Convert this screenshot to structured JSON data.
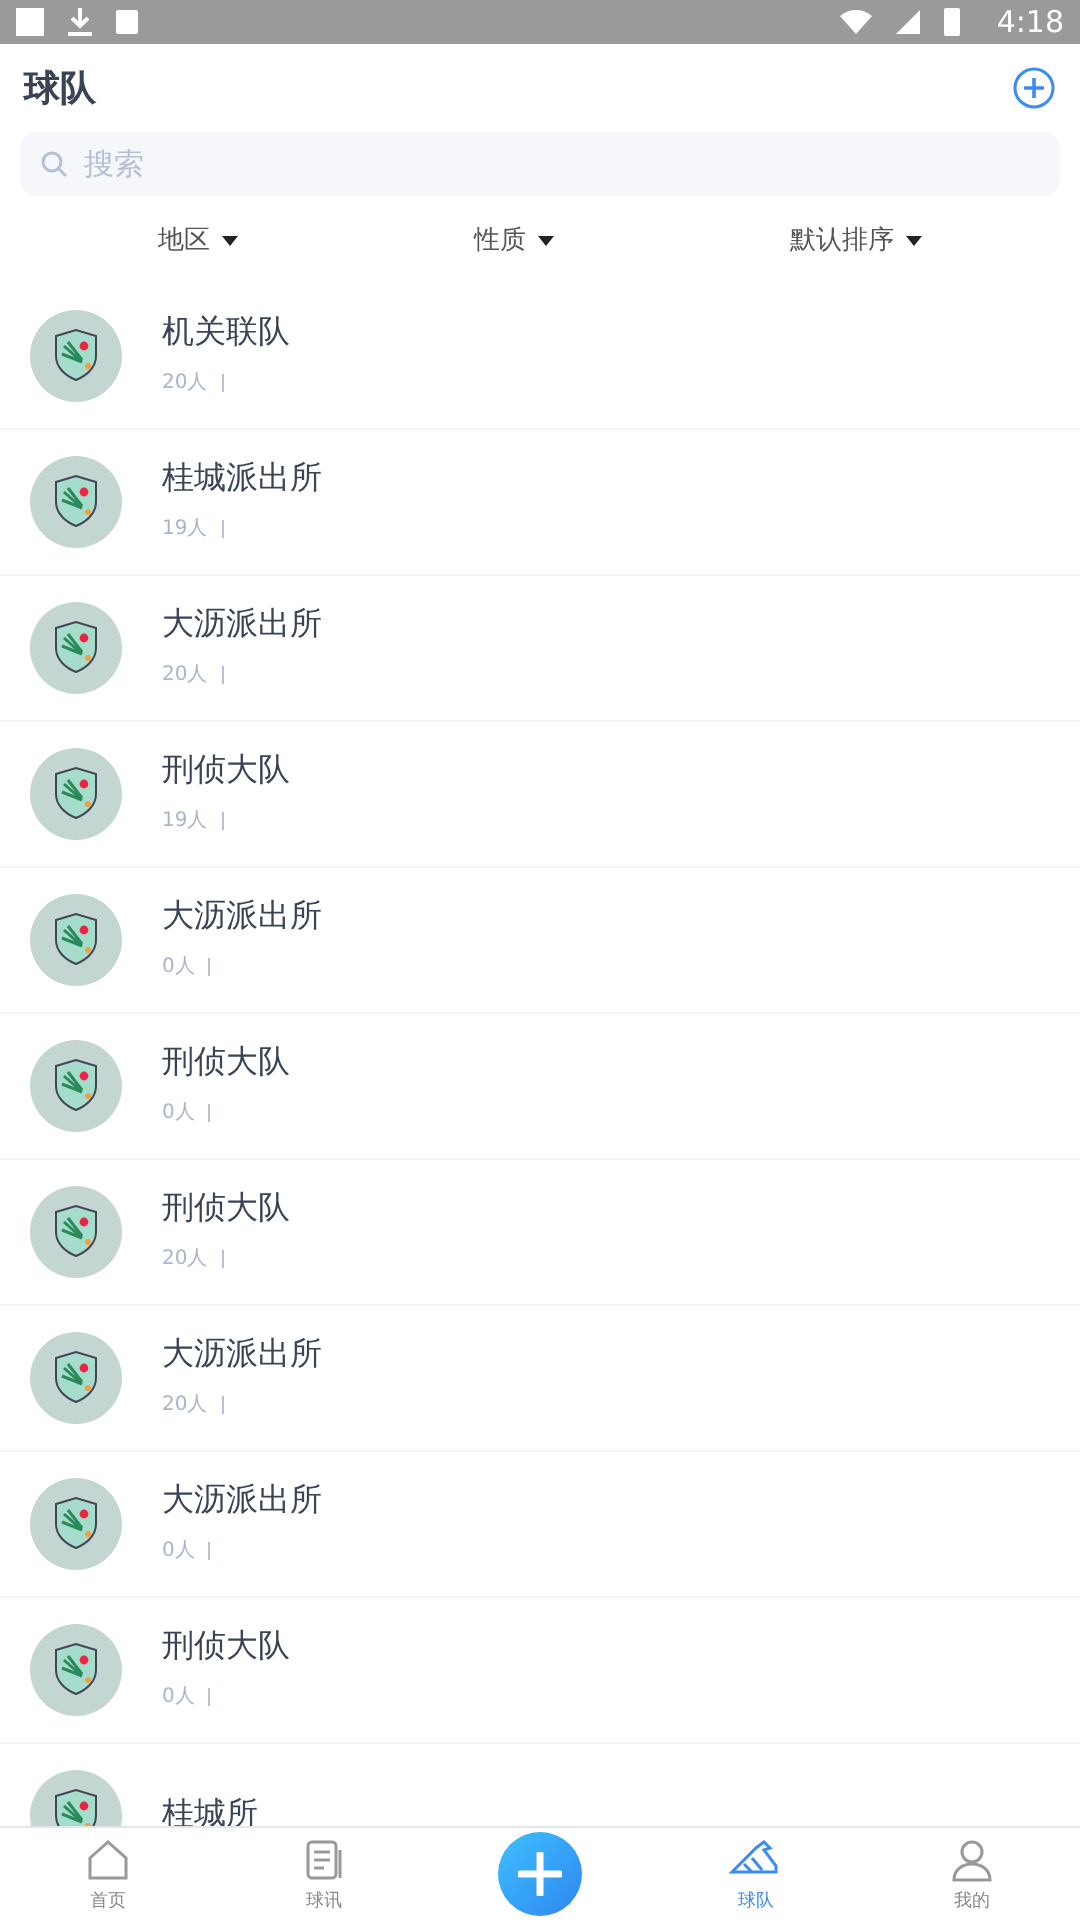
{
  "status_bar": {
    "time": "4:18"
  },
  "header": {
    "title": "球队"
  },
  "search": {
    "placeholder": "搜索"
  },
  "filters": [
    {
      "label": "地区"
    },
    {
      "label": "性质"
    },
    {
      "label": "默认排序"
    }
  ],
  "teams": [
    {
      "name": "机关联队",
      "count": "20人"
    },
    {
      "name": "桂城派出所",
      "count": "19人"
    },
    {
      "name": "大沥派出所",
      "count": "20人"
    },
    {
      "name": "刑侦大队",
      "count": "19人"
    },
    {
      "name": "大沥派出所",
      "count": "0人"
    },
    {
      "name": "刑侦大队",
      "count": "0人"
    },
    {
      "name": "刑侦大队",
      "count": "20人"
    },
    {
      "name": "大沥派出所",
      "count": "20人"
    },
    {
      "name": "大沥派出所",
      "count": "0人"
    },
    {
      "name": "刑侦大队",
      "count": "0人"
    },
    {
      "name": "桂城所"
    }
  ],
  "nav": [
    {
      "kind": "home",
      "label": "首页",
      "selected": false
    },
    {
      "kind": "news",
      "label": "球讯",
      "selected": false
    },
    {
      "kind": "add"
    },
    {
      "kind": "team",
      "label": "球队",
      "selected": true
    },
    {
      "kind": "me",
      "label": "我的",
      "selected": false
    }
  ]
}
